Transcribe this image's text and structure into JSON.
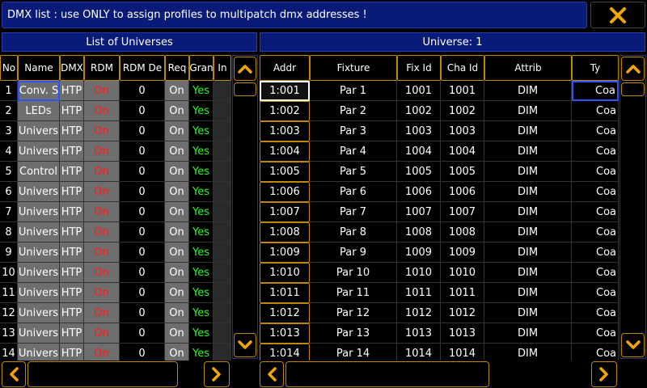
{
  "title": "DMX list : use ONLY to assign profiles to multipatch dmx addresses !",
  "icons": {
    "close": "close-x-icon",
    "up": "chevron-up-icon",
    "down": "chevron-down-icon",
    "left": "chevron-left-icon",
    "right": "chevron-right-icon"
  },
  "colors": {
    "accent": "#c08a00",
    "title_bg": "#0a1a78",
    "red": "#ff1a1a",
    "green": "#22ff22"
  },
  "left_panel": {
    "title": "List of Universes",
    "columns": [
      "No",
      "Name",
      "DMX",
      "RDM",
      "RDM De",
      "Req",
      "Gran",
      "In"
    ],
    "rows": [
      {
        "no": "1",
        "name": "Conv. S",
        "dmx": "HTP",
        "rdm": "On",
        "rdm_de": "0",
        "req": "On",
        "gran": "Yes"
      },
      {
        "no": "2",
        "name": "LEDs",
        "dmx": "HTP",
        "rdm": "On",
        "rdm_de": "0",
        "req": "On",
        "gran": "Yes"
      },
      {
        "no": "3",
        "name": "Univers",
        "dmx": "HTP",
        "rdm": "On",
        "rdm_de": "0",
        "req": "On",
        "gran": "Yes"
      },
      {
        "no": "4",
        "name": "Univers",
        "dmx": "HTP",
        "rdm": "On",
        "rdm_de": "0",
        "req": "On",
        "gran": "Yes"
      },
      {
        "no": "5",
        "name": "Control",
        "dmx": "HTP",
        "rdm": "On",
        "rdm_de": "0",
        "req": "On",
        "gran": "Yes"
      },
      {
        "no": "6",
        "name": "Univers",
        "dmx": "HTP",
        "rdm": "On",
        "rdm_de": "0",
        "req": "On",
        "gran": "Yes"
      },
      {
        "no": "7",
        "name": "Univers",
        "dmx": "HTP",
        "rdm": "On",
        "rdm_de": "0",
        "req": "On",
        "gran": "Yes"
      },
      {
        "no": "8",
        "name": "Univers",
        "dmx": "HTP",
        "rdm": "On",
        "rdm_de": "0",
        "req": "On",
        "gran": "Yes"
      },
      {
        "no": "9",
        "name": "Univers",
        "dmx": "HTP",
        "rdm": "On",
        "rdm_de": "0",
        "req": "On",
        "gran": "Yes"
      },
      {
        "no": "10",
        "name": "Univers",
        "dmx": "HTP",
        "rdm": "On",
        "rdm_de": "0",
        "req": "On",
        "gran": "Yes"
      },
      {
        "no": "11",
        "name": "Univers",
        "dmx": "HTP",
        "rdm": "On",
        "rdm_de": "0",
        "req": "On",
        "gran": "Yes"
      },
      {
        "no": "12",
        "name": "Univers",
        "dmx": "HTP",
        "rdm": "On",
        "rdm_de": "0",
        "req": "On",
        "gran": "Yes"
      },
      {
        "no": "13",
        "name": "Univers",
        "dmx": "HTP",
        "rdm": "On",
        "rdm_de": "0",
        "req": "On",
        "gran": "Yes"
      },
      {
        "no": "14",
        "name": "Univers",
        "dmx": "HTP",
        "rdm": "On",
        "rdm_de": "0",
        "req": "On",
        "gran": "Yes"
      }
    ]
  },
  "right_panel": {
    "title": "Universe: 1",
    "columns": [
      "Addr",
      "Fixture",
      "Fix Id",
      "Cha Id",
      "Attrib",
      "Ty"
    ],
    "rows": [
      {
        "addr": "1:001",
        "fixture": "Par 1",
        "fix_id": "1001",
        "cha_id": "1001",
        "attrib": "DIM",
        "type": "Coa"
      },
      {
        "addr": "1:002",
        "fixture": "Par 2",
        "fix_id": "1002",
        "cha_id": "1002",
        "attrib": "DIM",
        "type": "Coa"
      },
      {
        "addr": "1:003",
        "fixture": "Par 3",
        "fix_id": "1003",
        "cha_id": "1003",
        "attrib": "DIM",
        "type": "Coa"
      },
      {
        "addr": "1:004",
        "fixture": "Par 4",
        "fix_id": "1004",
        "cha_id": "1004",
        "attrib": "DIM",
        "type": "Coa"
      },
      {
        "addr": "1:005",
        "fixture": "Par 5",
        "fix_id": "1005",
        "cha_id": "1005",
        "attrib": "DIM",
        "type": "Coa"
      },
      {
        "addr": "1:006",
        "fixture": "Par 6",
        "fix_id": "1006",
        "cha_id": "1006",
        "attrib": "DIM",
        "type": "Coa"
      },
      {
        "addr": "1:007",
        "fixture": "Par 7",
        "fix_id": "1007",
        "cha_id": "1007",
        "attrib": "DIM",
        "type": "Coa"
      },
      {
        "addr": "1:008",
        "fixture": "Par 8",
        "fix_id": "1008",
        "cha_id": "1008",
        "attrib": "DIM",
        "type": "Coa"
      },
      {
        "addr": "1:009",
        "fixture": "Par 9",
        "fix_id": "1009",
        "cha_id": "1009",
        "attrib": "DIM",
        "type": "Coa"
      },
      {
        "addr": "1:010",
        "fixture": "Par 10",
        "fix_id": "1010",
        "cha_id": "1010",
        "attrib": "DIM",
        "type": "Coa"
      },
      {
        "addr": "1:011",
        "fixture": "Par 11",
        "fix_id": "1011",
        "cha_id": "1011",
        "attrib": "DIM",
        "type": "Coa"
      },
      {
        "addr": "1:012",
        "fixture": "Par 12",
        "fix_id": "1012",
        "cha_id": "1012",
        "attrib": "DIM",
        "type": "Coa"
      },
      {
        "addr": "1:013",
        "fixture": "Par 13",
        "fix_id": "1013",
        "cha_id": "1013",
        "attrib": "DIM",
        "type": "Coa"
      },
      {
        "addr": "1:014",
        "fixture": "Par 14",
        "fix_id": "1014",
        "cha_id": "1014",
        "attrib": "DIM",
        "type": "Coa"
      }
    ]
  }
}
